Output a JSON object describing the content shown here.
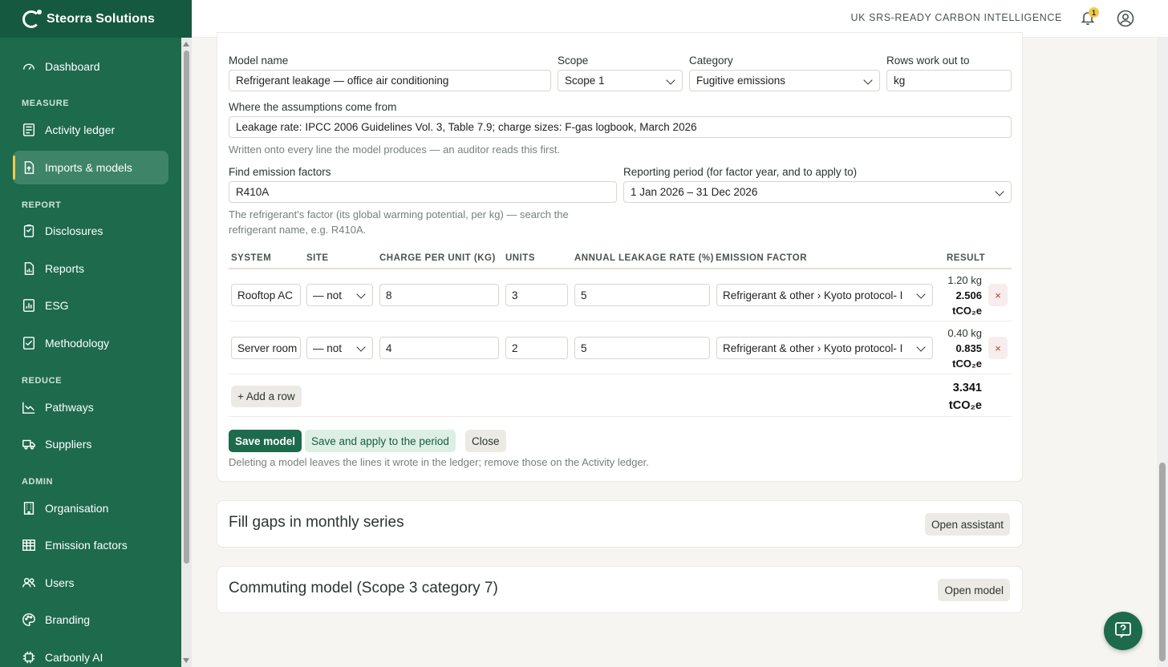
{
  "brand": {
    "name": "Steorra Solutions"
  },
  "topbar": {
    "title": "UK SRS-READY CARBON INTELLIGENCE",
    "notifications": "1"
  },
  "sidebar": {
    "sections": {
      "measure": "MEASURE",
      "report": "REPORT",
      "reduce": "REDUCE",
      "admin": "ADMIN"
    },
    "items": {
      "dashboard": "Dashboard",
      "activity_ledger": "Activity ledger",
      "imports_models": "Imports & models",
      "disclosures": "Disclosures",
      "reports": "Reports",
      "esg": "ESG",
      "methodology": "Methodology",
      "pathways": "Pathways",
      "suppliers": "Suppliers",
      "organisation": "Organisation",
      "emission_factors": "Emission factors",
      "users": "Users",
      "branding": "Branding",
      "carbonly_ai": "Carbonly AI"
    }
  },
  "form": {
    "model_name_label": "Model name",
    "model_name_value": "Refrigerant leakage — office air conditioning",
    "scope_label": "Scope",
    "scope_value": "Scope 1",
    "category_label": "Category",
    "category_value": "Fugitive emissions",
    "rows_unit_label": "Rows work out to",
    "rows_unit_value": "kg",
    "assumptions_label": "Where the assumptions come from",
    "assumptions_value": "Leakage rate: IPCC 2006 Guidelines Vol. 3, Table 7.9; charge sizes: F-gas logbook, March 2026",
    "assumptions_help": "Written onto every line the model produces — an auditor reads this first.",
    "factor_search_label": "Find emission factors",
    "factor_search_value": "R410A",
    "factor_search_help_1": "The refrigerant's factor (its global warming potential, per kg) — search the",
    "factor_search_help_2": "refrigerant name, e.g. R410A.",
    "period_label": "Reporting period (for factor year, and to apply to)",
    "period_value": "1 Jan 2026 – 31 Dec 2026"
  },
  "table": {
    "headers": {
      "system": "SYSTEM",
      "site": "SITE",
      "charge": "CHARGE PER UNIT (KG)",
      "units": "UNITS",
      "leak": "ANNUAL LEAKAGE RATE (%)",
      "factor": "EMISSION FACTOR",
      "result": "RESULT"
    },
    "rows": [
      {
        "system": "Rooftop AC",
        "site": "— not",
        "charge": "8",
        "units": "3",
        "leak": "5",
        "factor": "Refrigerant & other › Kyoto protocol- I",
        "result_kg": "1.20 kg",
        "result_t": "2.506",
        "result_unit": "tCO₂e",
        "delete": "×"
      },
      {
        "system": "Server room",
        "site": "— not",
        "charge": "4",
        "units": "2",
        "leak": "5",
        "factor": "Refrigerant & other › Kyoto protocol- I",
        "result_kg": "0.40 kg",
        "result_t": "0.835",
        "result_unit": "tCO₂e",
        "delete": "×"
      }
    ],
    "add_row": "+ Add a row",
    "total_value": "3.341",
    "total_unit": "tCO₂e"
  },
  "actions": {
    "save": "Save model",
    "save_apply": "Save and apply to the period",
    "close": "Close",
    "footnote": "Deleting a model leaves the lines it wrote in the ledger; remove those on the Activity ledger."
  },
  "cards": {
    "fill_gaps_title": "Fill gaps in monthly series",
    "fill_gaps_button": "Open assistant",
    "commuting_title": "Commuting model (Scope 3 category 7)",
    "commuting_button": "Open model"
  },
  "colors": {
    "sidebar": "#1d6a4d",
    "brand_bar": "#155a40",
    "accent": "#f2c94c",
    "primary_button": "#1d6a4d"
  }
}
